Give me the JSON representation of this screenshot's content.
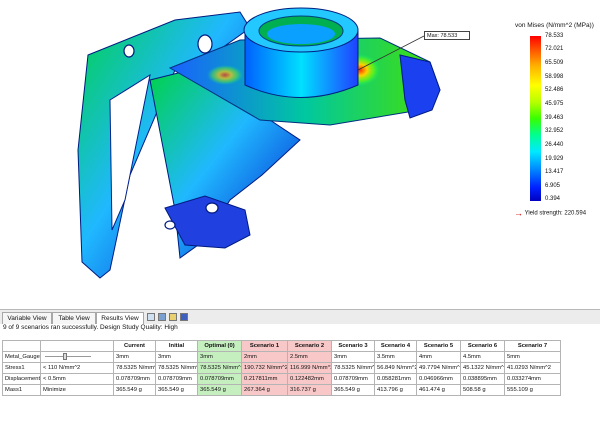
{
  "legend": {
    "title": "von Mises (N/mm^2 (MPa))",
    "values": [
      "78.533",
      "72.021",
      "65.509",
      "58.998",
      "52.486",
      "45.975",
      "39.463",
      "32.952",
      "26.440",
      "19.929",
      "13.417",
      "6.905",
      "0.394"
    ],
    "yield_label": "Yield strength: 220.594",
    "max_label": "Max: 78.533"
  },
  "tabs": [
    "Variable View",
    "Table View",
    "Results View"
  ],
  "toolbar_icons": [
    "results-grid-icon",
    "chart-icon",
    "update-icon",
    "save-icon"
  ],
  "status": "9 of 9 scenarios ran successfully. Design Study Quality: High",
  "table": {
    "columns": [
      "Current",
      "Initial",
      "Optimal (0)",
      "Scenario 1",
      "Scenario 2",
      "Scenario 3",
      "Scenario 4",
      "Scenario 5",
      "Scenario 6",
      "Scenario 7"
    ],
    "rows": [
      {
        "name": "Metal_Gauge",
        "constraint": "",
        "cells": [
          "3mm",
          "3mm",
          "3mm",
          "2mm",
          "2.5mm",
          "3mm",
          "3.5mm",
          "4mm",
          "4.5mm",
          "5mm"
        ]
      },
      {
        "name": "Stress1",
        "constraint": "< 110 N/mm^2",
        "cells": [
          "78.5325 N/mm^2",
          "78.5325 N/mm^2",
          "78.5325 N/mm^2",
          "190.732 N/mm^2",
          "116.999 N/mm^2",
          "78.5325 N/mm^2",
          "56.849 N/mm^2",
          "49.7794 N/mm^2",
          "45.1322 N/mm^2",
          "41.0293 N/mm^2"
        ]
      },
      {
        "name": "Displacement1",
        "constraint": "< 0.5mm",
        "cells": [
          "0.078709mm",
          "0.078709mm",
          "0.078709mm",
          "0.217811mm",
          "0.122482mm",
          "0.078709mm",
          "0.058281mm",
          "0.046966mm",
          "0.038895mm",
          "0.033274mm"
        ]
      },
      {
        "name": "Mass1",
        "constraint": "Minimize",
        "cells": [
          "365.549 g",
          "365.549 g",
          "365.549 g",
          "267.364 g",
          "316.737 g",
          "365.549 g",
          "413.796 g",
          "461.474 g",
          "508.58 g",
          "555.109 g"
        ]
      }
    ]
  }
}
